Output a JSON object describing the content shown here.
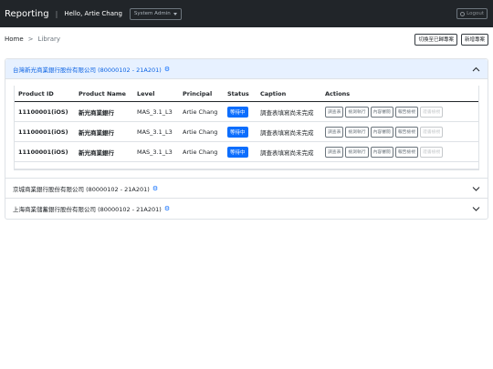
{
  "navbar": {
    "brand": "Reporting",
    "separator": "|",
    "greeting": "Hello, Artie Chang",
    "role": "System Admin",
    "logout": "Logout"
  },
  "breadcrumb": {
    "home": "Home",
    "separator": ">",
    "current": "Library"
  },
  "top_actions": {
    "switch_label": "切換至已歸專案",
    "new_label": "新增專案"
  },
  "sections": [
    {
      "title": "台灣新光商業銀行股份有限公司 (80000102 - 21A201)"
    },
    {
      "title": "京城商業銀行股份有限公司 (80000102 - 21A201)"
    },
    {
      "title": "上海商業儲蓄銀行股份有限公司 (80000102 - 21A201)"
    }
  ],
  "table": {
    "headers": [
      "Product ID",
      "Product Name",
      "Level",
      "Principal",
      "Status",
      "Caption",
      "Actions"
    ],
    "rows": [
      {
        "id": "11100001(iOS)",
        "name": "新光商業銀行",
        "level": "MAS_3.1_L3",
        "principal": "Artie Chang",
        "status": "等待中",
        "caption": "調查表填寫尚未完成"
      },
      {
        "id": "11100001(iOS)",
        "name": "新光商業銀行",
        "level": "MAS_3.1_L3",
        "principal": "Artie Chang",
        "status": "等待中",
        "caption": "調查表填寫尚未完成"
      },
      {
        "id": "11100001(iOS)",
        "name": "新光商業銀行",
        "level": "MAS_3.1_L3",
        "principal": "Artie Chang",
        "status": "等待中",
        "caption": "調查表填寫尚未完成"
      }
    ],
    "action_labels": [
      "調查表",
      "檢測執行",
      "內容審閱",
      "報告檢視",
      "證書檢視"
    ]
  },
  "colors": {
    "navbar_bg": "#212529",
    "accent": "#0d6efd",
    "open_header_bg": "#e7f1ff"
  },
  "icons": {
    "gear": "gear-icon",
    "chevron": "chevron-icon",
    "power": "power-icon"
  }
}
